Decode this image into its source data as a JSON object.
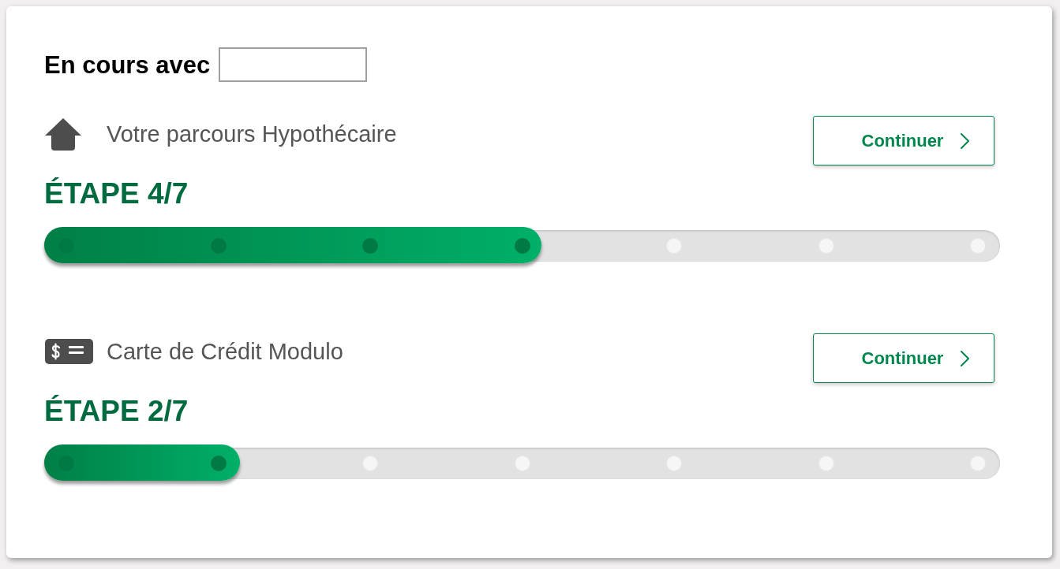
{
  "header": {
    "title": "En cours avec"
  },
  "journeys": [
    {
      "kind": "mortgage",
      "title": "Votre parcours Hypothécaire",
      "button": "Continuer",
      "step_label": "ÉTAPE 4/7",
      "progress": {
        "level": 0.52
      },
      "steps": [
        {
          "done": true
        },
        {
          "done": true
        },
        {
          "done": true
        },
        {
          "done": true
        },
        {
          "done": false
        },
        {
          "done": false
        },
        {
          "done": false
        }
      ]
    },
    {
      "kind": "credit-card",
      "title": "Carte de Crédit Modulo",
      "button": "Continuer",
      "step_label": "ÉTAPE 2/7",
      "progress": {
        "level": 0.205
      },
      "steps": [
        {
          "done": true
        },
        {
          "done": true
        },
        {
          "done": false
        },
        {
          "done": false
        },
        {
          "done": false
        },
        {
          "done": false
        },
        {
          "done": false
        }
      ]
    }
  ]
}
